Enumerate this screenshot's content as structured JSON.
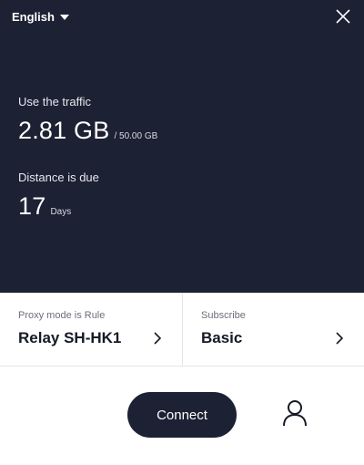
{
  "header": {
    "language": "English",
    "language_icon": "caret-down-icon",
    "close_icon": "close-icon"
  },
  "traffic": {
    "label": "Use the traffic",
    "used": "2.81 GB",
    "total": "/ 50.00 GB"
  },
  "due": {
    "label": "Distance is due",
    "value": "17",
    "unit": "Days"
  },
  "cards": [
    {
      "label": "Proxy mode is Rule",
      "value": "Relay SH-HK1",
      "icon": "chevron-right-icon"
    },
    {
      "label": "Subscribe",
      "value": "Basic",
      "icon": "chevron-right-icon"
    }
  ],
  "actions": {
    "connect_label": "Connect",
    "user_icon": "user-icon"
  },
  "colors": {
    "panel": "#1c2133",
    "text_dark": "#161a26",
    "muted": "#6b6f7a"
  }
}
